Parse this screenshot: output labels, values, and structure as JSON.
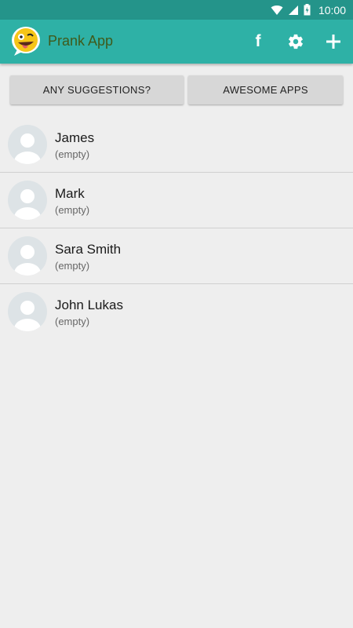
{
  "status_bar": {
    "time": "10:00",
    "icons": [
      "wifi-icon",
      "signal-icon",
      "battery-charging-icon"
    ]
  },
  "app_bar": {
    "title": "Prank App",
    "logo": "tongue-out-emoji-logo",
    "actions": [
      {
        "icon": "facebook-icon"
      },
      {
        "icon": "gear-icon"
      },
      {
        "icon": "plus-icon"
      }
    ],
    "background": "#2eb1a6",
    "status_background": "#24948a",
    "title_color": "#3f5a1b"
  },
  "buttons": {
    "suggestions_label": "ANY SUGGESTIONS?",
    "awesome_label": "AWESOME APPS"
  },
  "contacts": [
    {
      "name": "James",
      "status": "(empty)"
    },
    {
      "name": "Mark",
      "status": "(empty)"
    },
    {
      "name": "Sara Smith",
      "status": "(empty)"
    },
    {
      "name": "John Lukas",
      "status": "(empty)"
    }
  ],
  "colors": {
    "page_background": "#eeeeee",
    "button_background": "#d7d7d7",
    "avatar_background": "#dde3e6"
  }
}
